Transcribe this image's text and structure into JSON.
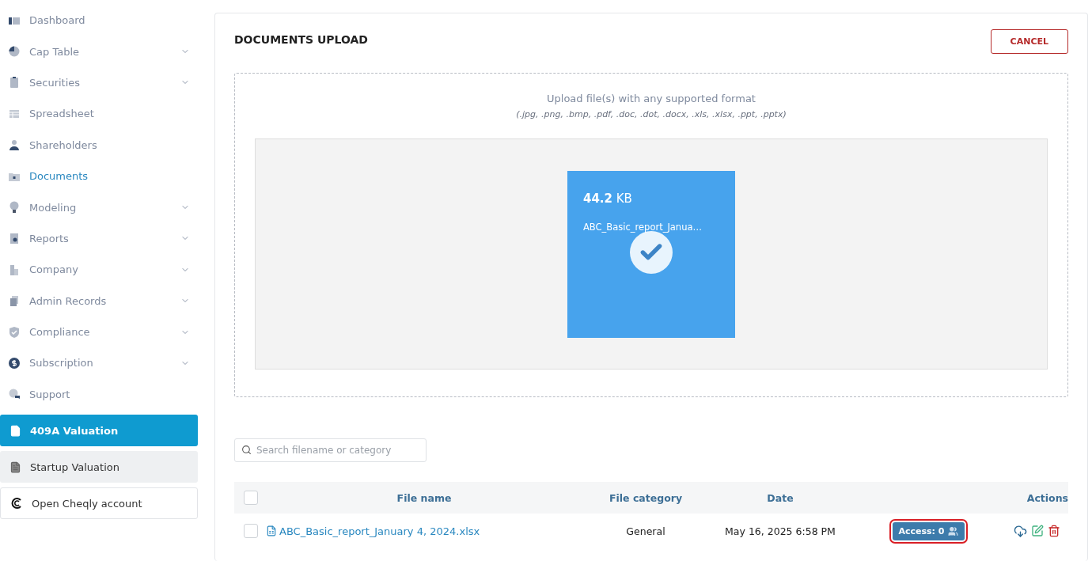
{
  "sidebar": {
    "items": [
      {
        "label": "Dashboard",
        "kind": "dashboard",
        "expandable": false,
        "selected": false
      },
      {
        "label": "Cap Table",
        "kind": "pie",
        "expandable": true,
        "selected": false
      },
      {
        "label": "Securities",
        "kind": "clipboard",
        "expandable": true,
        "selected": false
      },
      {
        "label": "Spreadsheet",
        "kind": "table",
        "expandable": false,
        "selected": false
      },
      {
        "label": "Shareholders",
        "kind": "person",
        "expandable": false,
        "selected": false
      },
      {
        "label": "Documents",
        "kind": "folder",
        "expandable": false,
        "selected": true
      },
      {
        "label": "Modeling",
        "kind": "bulb",
        "expandable": true,
        "selected": false
      },
      {
        "label": "Reports",
        "kind": "report",
        "expandable": true,
        "selected": false
      },
      {
        "label": "Company",
        "kind": "building",
        "expandable": true,
        "selected": false
      },
      {
        "label": "Admin Records",
        "kind": "records",
        "expandable": true,
        "selected": false
      },
      {
        "label": "Compliance",
        "kind": "shield",
        "expandable": true,
        "selected": false
      },
      {
        "label": "Subscription",
        "kind": "dollar",
        "expandable": true,
        "selected": false
      },
      {
        "label": "Support",
        "kind": "chat",
        "expandable": false,
        "selected": false
      }
    ],
    "actions": [
      {
        "kind": "primary",
        "label": "409A Valuation"
      },
      {
        "kind": "secondary",
        "label": "Startup Valuation"
      },
      {
        "kind": "outline",
        "label": "Open Cheqly account"
      }
    ]
  },
  "panel": {
    "title": "DOCUMENTS UPLOAD",
    "cancel": "CANCEL",
    "dropzone": {
      "hint": "Upload file(s) with any supported format",
      "formats": "(.jpg, .png, .bmp, .pdf, .doc, .dot, .docx, .xls, .xlsx, .ppt, .pptx)",
      "file": {
        "size": "**44.2** KB",
        "name": "ABC_Basic_report_Janua…",
        "uploaded": true
      }
    },
    "search": {
      "placeholder": "Search filename or category"
    },
    "table": {
      "columns": [
        "File name",
        "File category",
        "Date",
        "Actions"
      ],
      "all_checked": false,
      "rows": [
        {
          "checked": false,
          "file_name": "ABC_Basic_report_January 4, 2024.xlsx",
          "category": "General",
          "date": "May 16, 2025 6:58 PM",
          "access": "Access: 0",
          "highlighted": true
        }
      ]
    }
  }
}
